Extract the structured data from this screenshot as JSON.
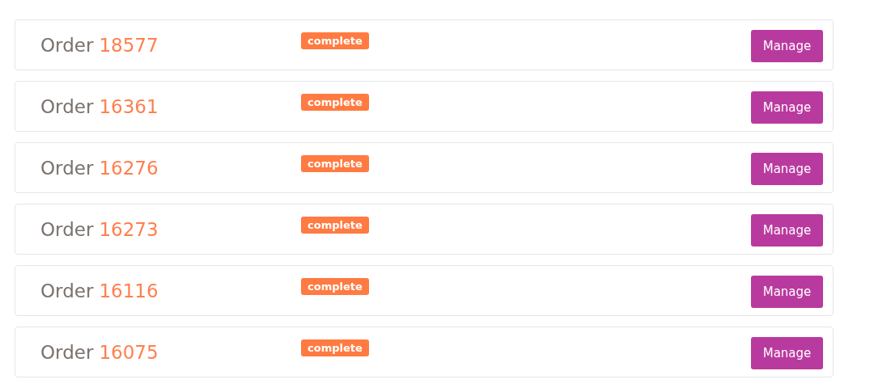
{
  "orders": [
    {
      "label": "Order",
      "number": "18577",
      "status": "complete",
      "action": "Manage"
    },
    {
      "label": "Order",
      "number": "16361",
      "status": "complete",
      "action": "Manage"
    },
    {
      "label": "Order",
      "number": "16276",
      "status": "complete",
      "action": "Manage"
    },
    {
      "label": "Order",
      "number": "16273",
      "status": "complete",
      "action": "Manage"
    },
    {
      "label": "Order",
      "number": "16116",
      "status": "complete",
      "action": "Manage"
    },
    {
      "label": "Order",
      "number": "16075",
      "status": "complete",
      "action": "Manage"
    }
  ]
}
